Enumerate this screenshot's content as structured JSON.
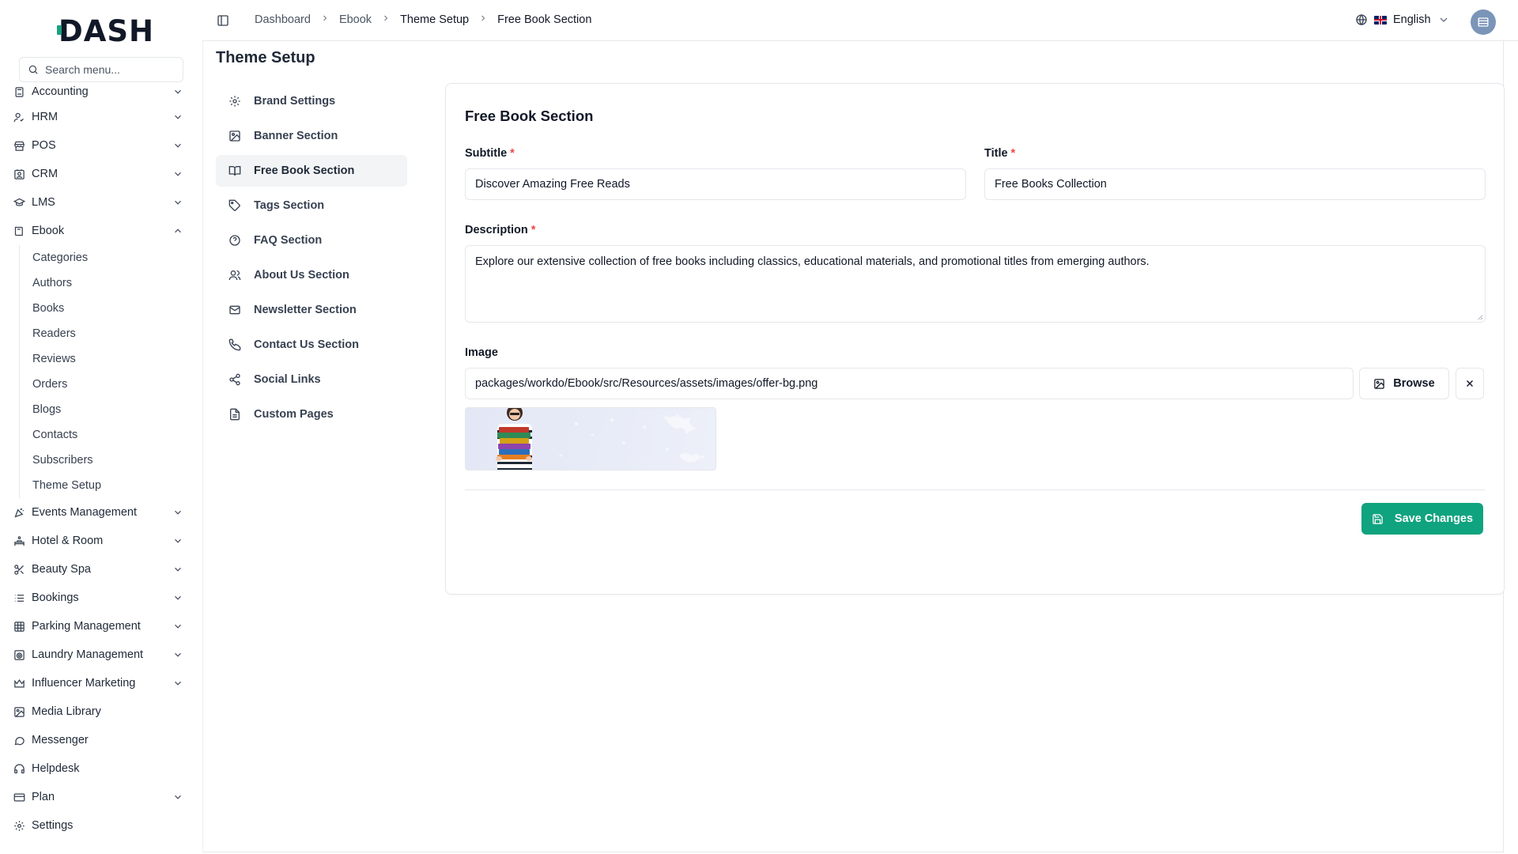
{
  "brand": {
    "logo_text": "DASH",
    "accent": "#10a37f"
  },
  "search": {
    "placeholder": "Search menu..."
  },
  "sidebar": {
    "items": [
      {
        "label": "Accounting",
        "icon": "calculator-icon",
        "expandable": true
      },
      {
        "label": "HRM",
        "icon": "users-icon",
        "expandable": true
      },
      {
        "label": "POS",
        "icon": "store-icon",
        "expandable": true
      },
      {
        "label": "CRM",
        "icon": "contact-card-icon",
        "expandable": true
      },
      {
        "label": "LMS",
        "icon": "graduation-cap-icon",
        "expandable": true
      },
      {
        "label": "Ebook",
        "icon": "book-icon",
        "expandable": true,
        "expanded": true
      }
    ],
    "ebook_children": [
      "Categories",
      "Authors",
      "Books",
      "Readers",
      "Reviews",
      "Orders",
      "Blogs",
      "Contacts",
      "Subscribers",
      "Theme Setup"
    ],
    "items_after": [
      {
        "label": "Events Management",
        "icon": "party-popper-icon",
        "expandable": true
      },
      {
        "label": "Hotel & Room",
        "icon": "hotel-icon",
        "expandable": true
      },
      {
        "label": "Beauty Spa",
        "icon": "scissors-icon",
        "expandable": true
      },
      {
        "label": "Bookings",
        "icon": "list-icon",
        "expandable": true
      },
      {
        "label": "Parking Management",
        "icon": "grid-icon",
        "expandable": true
      },
      {
        "label": "Laundry Management",
        "icon": "washing-machine-icon",
        "expandable": true
      },
      {
        "label": "Influencer Marketing",
        "icon": "crown-icon",
        "expandable": true
      },
      {
        "label": "Media Library",
        "icon": "image-icon",
        "expandable": false
      },
      {
        "label": "Messenger",
        "icon": "message-circle-icon",
        "expandable": false
      },
      {
        "label": "Helpdesk",
        "icon": "headphones-icon",
        "expandable": false
      },
      {
        "label": "Plan",
        "icon": "credit-card-icon",
        "expandable": true
      },
      {
        "label": "Settings",
        "icon": "gear-icon",
        "expandable": false
      }
    ]
  },
  "topbar": {
    "breadcrumb": [
      "Dashboard",
      "Ebook",
      "Theme Setup",
      "Free Book Section"
    ],
    "language": "English"
  },
  "page": {
    "title": "Theme Setup"
  },
  "theme_nav": [
    {
      "label": "Brand Settings",
      "icon": "gear-icon"
    },
    {
      "label": "Banner Section",
      "icon": "image-icon"
    },
    {
      "label": "Free Book Section",
      "icon": "book-open-icon",
      "active": true
    },
    {
      "label": "Tags Section",
      "icon": "tag-icon"
    },
    {
      "label": "FAQ Section",
      "icon": "help-circle-icon"
    },
    {
      "label": "About Us Section",
      "icon": "users-icon"
    },
    {
      "label": "Newsletter Section",
      "icon": "mail-icon"
    },
    {
      "label": "Contact Us Section",
      "icon": "phone-icon"
    },
    {
      "label": "Social Links",
      "icon": "share-icon"
    },
    {
      "label": "Custom Pages",
      "icon": "file-text-icon"
    }
  ],
  "form": {
    "heading": "Free Book Section",
    "subtitle_label": "Subtitle",
    "subtitle_value": "Discover Amazing Free Reads",
    "title_label": "Title",
    "title_value": "Free Books Collection",
    "description_label": "Description",
    "description_value": "Explore our extensive collection of free books including classics, educational materials, and promotional titles from emerging authors.",
    "image_label": "Image",
    "image_path": "packages/workdo/Ebook/src/Resources/assets/images/offer-bg.png",
    "browse_label": "Browse",
    "required_mark": "*",
    "save_label": "Save Changes"
  }
}
